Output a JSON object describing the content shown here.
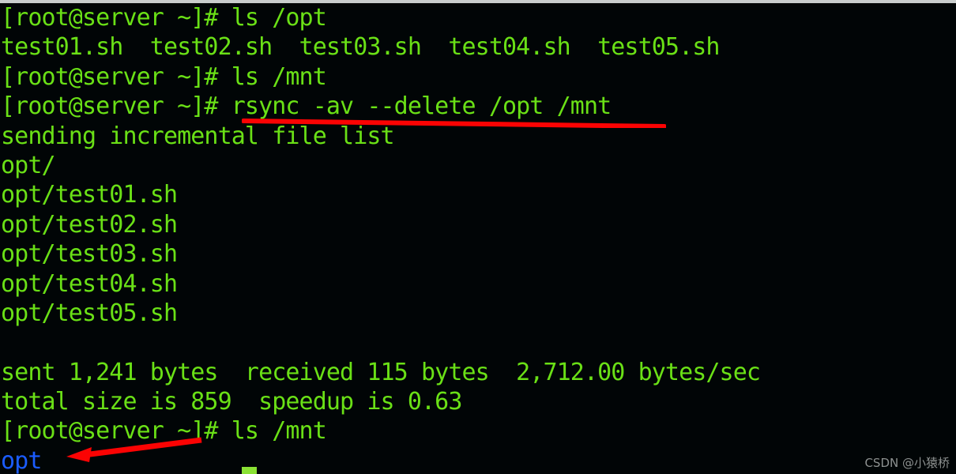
{
  "terminal": {
    "title": "root@server terminal",
    "background_color": "#010506",
    "foreground_color": "#5ee011",
    "directory_color": "#1b5cff",
    "annotation_color": "#fb0303",
    "lines": [
      {
        "id": "l01",
        "text": "[root@server ~]# ls /opt",
        "color": "green"
      },
      {
        "id": "l02",
        "text": "test01.sh  test02.sh  test03.sh  test04.sh  test05.sh",
        "color": "green"
      },
      {
        "id": "l03",
        "text": "[root@server ~]# ls /mnt",
        "color": "green"
      },
      {
        "id": "l04",
        "text": "[root@server ~]# rsync -av --delete /opt /mnt",
        "color": "green"
      },
      {
        "id": "l05",
        "text": "sending incremental file list",
        "color": "green"
      },
      {
        "id": "l06",
        "text": "opt/",
        "color": "green"
      },
      {
        "id": "l07",
        "text": "opt/test01.sh",
        "color": "green"
      },
      {
        "id": "l08",
        "text": "opt/test02.sh",
        "color": "green"
      },
      {
        "id": "l09",
        "text": "opt/test03.sh",
        "color": "green"
      },
      {
        "id": "l10",
        "text": "opt/test04.sh",
        "color": "green"
      },
      {
        "id": "l11",
        "text": "opt/test05.sh",
        "color": "green"
      },
      {
        "id": "l12",
        "text": "",
        "color": "green"
      },
      {
        "id": "l13",
        "text": "sent 1,241 bytes  received 115 bytes  2,712.00 bytes/sec",
        "color": "green"
      },
      {
        "id": "l14",
        "text": "total size is 859  speedup is 0.63",
        "color": "green"
      },
      {
        "id": "l15",
        "text": "[root@server ~]# ls /mnt",
        "color": "green"
      },
      {
        "id": "l16",
        "text": "opt",
        "color": "blue"
      }
    ],
    "prompt": "[root@server ~]#",
    "hostname": "server",
    "user": "root",
    "cwd": "~"
  },
  "annotations": {
    "underline": {
      "name": "red-underline-rsync-command",
      "color": "#fb0303",
      "targets": "rsync -av --delete /opt /mnt"
    },
    "arrow": {
      "name": "red-arrow-to-opt",
      "color": "#fb0303",
      "targets": "opt"
    }
  },
  "watermark": {
    "text": "CSDN @小猿桥",
    "color": "#8d9190"
  }
}
